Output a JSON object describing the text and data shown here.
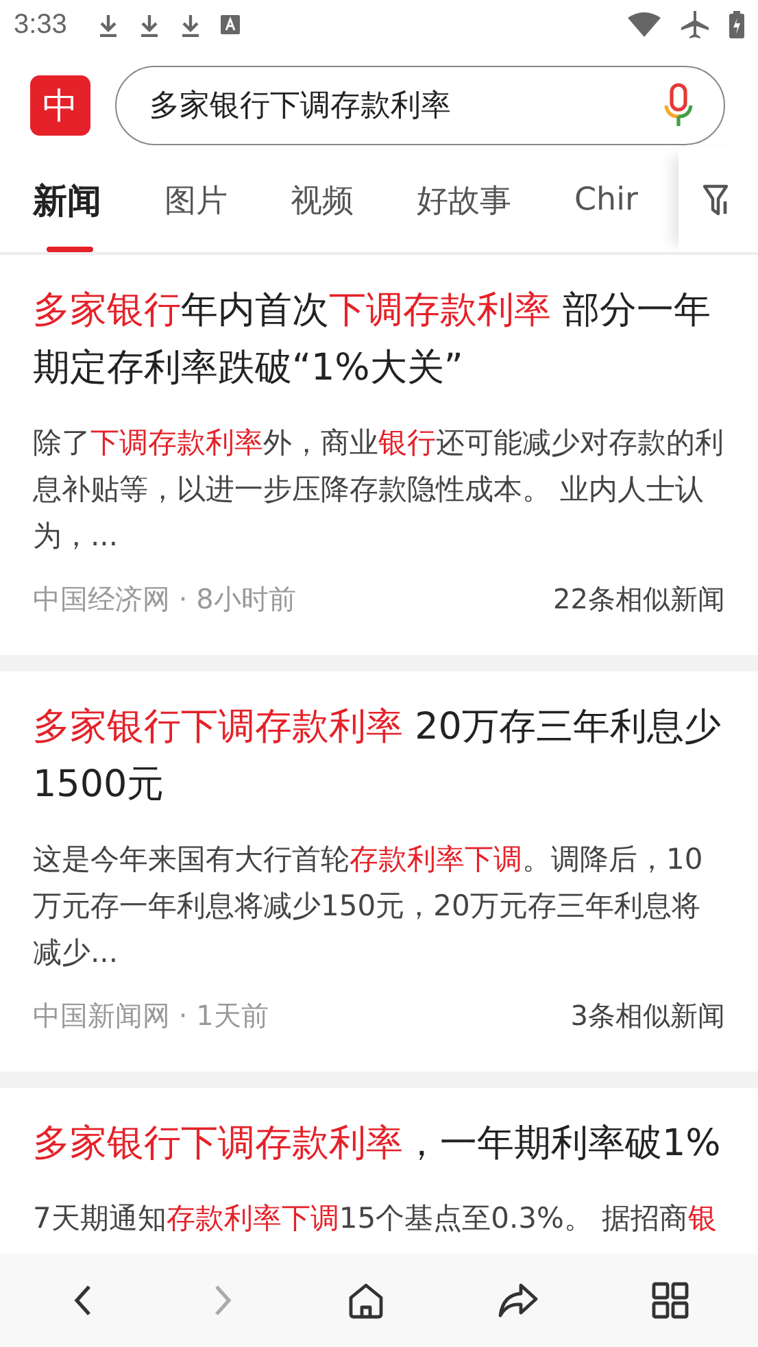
{
  "status_bar": {
    "time": "3:33"
  },
  "search": {
    "logo": "中",
    "value": "多家银行下调存款利率"
  },
  "tabs": [
    {
      "label": "新闻",
      "selected": true
    },
    {
      "label": "图片",
      "selected": false
    },
    {
      "label": "视频",
      "selected": false
    },
    {
      "label": "好故事",
      "selected": false
    },
    {
      "label": "Chir",
      "selected": false
    }
  ],
  "results": [
    {
      "title": [
        {
          "text": "多家银行",
          "highlight": true
        },
        {
          "text": "年内首次",
          "highlight": false
        },
        {
          "text": "下调存款利率",
          "highlight": true
        },
        {
          "text": " 部分一年期定存利率跌破“1%大关”",
          "highlight": false
        }
      ],
      "snippet": [
        {
          "text": "除了",
          "highlight": false
        },
        {
          "text": "下调存款利率",
          "highlight": true
        },
        {
          "text": "外，商业",
          "highlight": false
        },
        {
          "text": "银行",
          "highlight": true
        },
        {
          "text": "还可能减少对存款的利息补贴等，以进一步压降存款隐性成本。 业内人士认为，...",
          "highlight": false
        }
      ],
      "source": "中国经济网 · 8小时前",
      "similar": "22条相似新闻"
    },
    {
      "title": [
        {
          "text": "多家银行下调存款利率",
          "highlight": true
        },
        {
          "text": " 20万存三年利息少1500元",
          "highlight": false
        }
      ],
      "snippet": [
        {
          "text": "这是今年来国有大行首轮",
          "highlight": false
        },
        {
          "text": "存款利率下调",
          "highlight": true
        },
        {
          "text": "。调降后，10万元存一年利息将减少150元，20万元存三年利息将减少...",
          "highlight": false
        }
      ],
      "source": "中国新闻网 · 1天前",
      "similar": "3条相似新闻"
    },
    {
      "title": [
        {
          "text": "多家银行下调存款利率",
          "highlight": true
        },
        {
          "text": "，一年期利率破1%",
          "highlight": false
        }
      ],
      "snippet": [
        {
          "text": "7天期通知",
          "highlight": false
        },
        {
          "text": "存款利率下调",
          "highlight": true
        },
        {
          "text": "15个基点至0.3%。 据招商",
          "highlight": false
        },
        {
          "text": "银",
          "highlight": true
        }
      ]
    }
  ],
  "bottom_nav": [
    {
      "kind": "back",
      "disabled": false
    },
    {
      "kind": "forward",
      "disabled": true
    },
    {
      "kind": "home",
      "disabled": false
    },
    {
      "kind": "share",
      "disabled": false
    },
    {
      "kind": "tabs",
      "disabled": false
    }
  ]
}
